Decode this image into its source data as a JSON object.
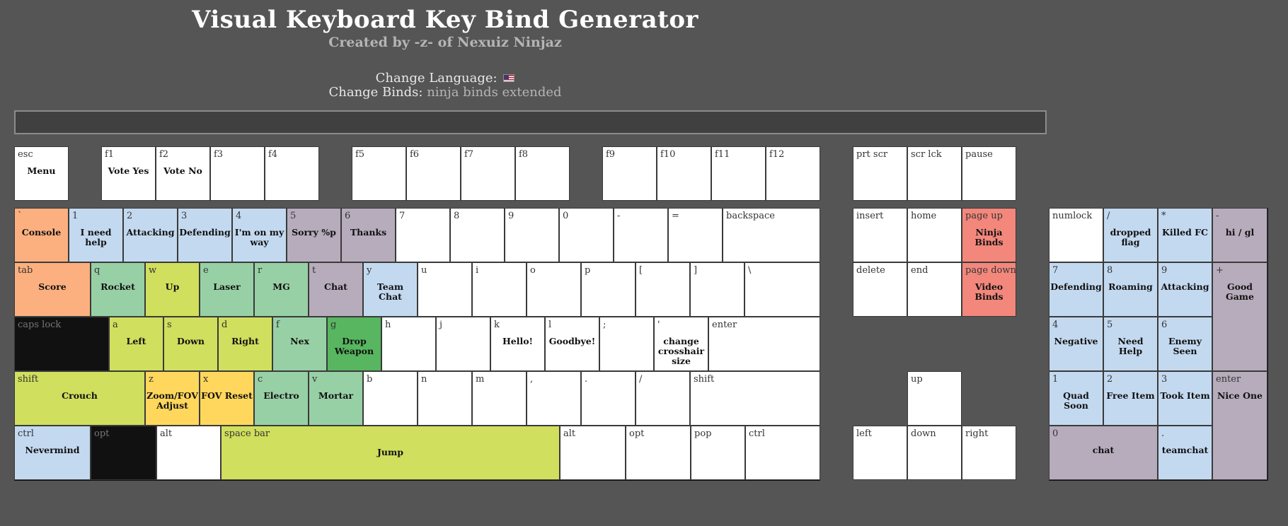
{
  "header": {
    "title": "Visual Keyboard Key Bind Generator",
    "subtitle": "Created by -z- of Nexuiz Ninjaz",
    "language_label": "Change Language:",
    "binds_label": "Change Binds:",
    "binds_value": "ninja binds extended"
  },
  "colors": {
    "background": "#555555",
    "orange": "#fcb07f",
    "blue": "#c3d9f0",
    "mauve": "#b6acbb",
    "green": "#98d0a6",
    "lime": "#d0df5d",
    "dark_green": "#57b65f",
    "yellow": "#ffd75c",
    "red": "#f3877c",
    "black": "#111111",
    "white": "#ffffff"
  },
  "keys": [
    {
      "id": "esc",
      "label": "esc",
      "bind": "Menu",
      "color": "white"
    },
    {
      "id": "f1",
      "label": "f1",
      "bind": "Vote Yes",
      "color": "white"
    },
    {
      "id": "f2",
      "label": "f2",
      "bind": "Vote No",
      "color": "white"
    },
    {
      "id": "f3",
      "label": "f3",
      "bind": "",
      "color": "white"
    },
    {
      "id": "f4",
      "label": "f4",
      "bind": "",
      "color": "white"
    },
    {
      "id": "f5",
      "label": "f5",
      "bind": "",
      "color": "white"
    },
    {
      "id": "f6",
      "label": "f6",
      "bind": "",
      "color": "white"
    },
    {
      "id": "f7",
      "label": "f7",
      "bind": "",
      "color": "white"
    },
    {
      "id": "f8",
      "label": "f8",
      "bind": "",
      "color": "white"
    },
    {
      "id": "f9",
      "label": "f9",
      "bind": "",
      "color": "white"
    },
    {
      "id": "f10",
      "label": "f10",
      "bind": "",
      "color": "white"
    },
    {
      "id": "f11",
      "label": "f11",
      "bind": "",
      "color": "white"
    },
    {
      "id": "f12",
      "label": "f12",
      "bind": "",
      "color": "white"
    },
    {
      "id": "prtscr",
      "label": "prt scr",
      "bind": "",
      "color": "white"
    },
    {
      "id": "scrlck",
      "label": "scr lck",
      "bind": "",
      "color": "white"
    },
    {
      "id": "pause",
      "label": "pause",
      "bind": "",
      "color": "white"
    },
    {
      "id": "backtick",
      "label": "`",
      "bind": "Console",
      "color": "orange"
    },
    {
      "id": "1",
      "label": "1",
      "bind": "I need help",
      "color": "blue"
    },
    {
      "id": "2",
      "label": "2",
      "bind": "Attacking",
      "color": "blue"
    },
    {
      "id": "3",
      "label": "3",
      "bind": "Defending",
      "color": "blue"
    },
    {
      "id": "4",
      "label": "4",
      "bind": "I'm on my way",
      "color": "blue"
    },
    {
      "id": "5",
      "label": "5",
      "bind": "Sorry %p",
      "color": "mauve"
    },
    {
      "id": "6",
      "label": "6",
      "bind": "Thanks",
      "color": "mauve"
    },
    {
      "id": "7",
      "label": "7",
      "bind": "",
      "color": "white"
    },
    {
      "id": "8",
      "label": "8",
      "bind": "",
      "color": "white"
    },
    {
      "id": "9",
      "label": "9",
      "bind": "",
      "color": "white"
    },
    {
      "id": "0",
      "label": "0",
      "bind": "",
      "color": "white"
    },
    {
      "id": "minus",
      "label": "-",
      "bind": "",
      "color": "white"
    },
    {
      "id": "equals",
      "label": "=",
      "bind": "",
      "color": "white"
    },
    {
      "id": "backspace",
      "label": "backspace",
      "bind": "",
      "color": "white"
    },
    {
      "id": "tab",
      "label": "tab",
      "bind": "Score",
      "color": "orange"
    },
    {
      "id": "q",
      "label": "q",
      "bind": "Rocket",
      "color": "green"
    },
    {
      "id": "w",
      "label": "w",
      "bind": "Up",
      "color": "lime"
    },
    {
      "id": "e",
      "label": "e",
      "bind": "Laser",
      "color": "green"
    },
    {
      "id": "r",
      "label": "r",
      "bind": "MG",
      "color": "green"
    },
    {
      "id": "t",
      "label": "t",
      "bind": "Chat",
      "color": "mauve"
    },
    {
      "id": "y",
      "label": "y",
      "bind": "Team Chat",
      "color": "blue"
    },
    {
      "id": "u",
      "label": "u",
      "bind": "",
      "color": "white"
    },
    {
      "id": "i",
      "label": "i",
      "bind": "",
      "color": "white"
    },
    {
      "id": "o",
      "label": "o",
      "bind": "",
      "color": "white"
    },
    {
      "id": "p",
      "label": "p",
      "bind": "",
      "color": "white"
    },
    {
      "id": "lbracket",
      "label": "[",
      "bind": "",
      "color": "white"
    },
    {
      "id": "rbracket",
      "label": "]",
      "bind": "",
      "color": "white"
    },
    {
      "id": "backslash",
      "label": "\\",
      "bind": "",
      "color": "white"
    },
    {
      "id": "capslock",
      "label": "caps lock",
      "bind": "",
      "color": "black"
    },
    {
      "id": "a",
      "label": "a",
      "bind": "Left",
      "color": "lime"
    },
    {
      "id": "s",
      "label": "s",
      "bind": "Down",
      "color": "lime"
    },
    {
      "id": "d",
      "label": "d",
      "bind": "Right",
      "color": "lime"
    },
    {
      "id": "f",
      "label": "f",
      "bind": "Nex",
      "color": "green"
    },
    {
      "id": "g",
      "label": "g",
      "bind": "Drop Weapon",
      "color": "dgreen"
    },
    {
      "id": "h",
      "label": "h",
      "bind": "",
      "color": "white"
    },
    {
      "id": "j",
      "label": "j",
      "bind": "",
      "color": "white"
    },
    {
      "id": "k",
      "label": "k",
      "bind": "Hello!",
      "color": "white"
    },
    {
      "id": "l",
      "label": "l",
      "bind": "Goodbye!",
      "color": "white"
    },
    {
      "id": "semicolon",
      "label": ";",
      "bind": "",
      "color": "white"
    },
    {
      "id": "quote",
      "label": "'",
      "bind": "change crosshair size",
      "color": "white"
    },
    {
      "id": "enter",
      "label": "enter",
      "bind": "",
      "color": "white"
    },
    {
      "id": "lshift",
      "label": "shift",
      "bind": "Crouch",
      "color": "lime"
    },
    {
      "id": "z",
      "label": "z",
      "bind": "Zoom/FOV Adjust",
      "color": "yellow"
    },
    {
      "id": "x",
      "label": "x",
      "bind": "FOV Reset",
      "color": "yellow"
    },
    {
      "id": "c",
      "label": "c",
      "bind": "Electro",
      "color": "green"
    },
    {
      "id": "v",
      "label": "v",
      "bind": "Mortar",
      "color": "green"
    },
    {
      "id": "b",
      "label": "b",
      "bind": "",
      "color": "white"
    },
    {
      "id": "n",
      "label": "n",
      "bind": "",
      "color": "white"
    },
    {
      "id": "m",
      "label": "m",
      "bind": "",
      "color": "white"
    },
    {
      "id": "comma",
      "label": ",",
      "bind": "",
      "color": "white"
    },
    {
      "id": "period",
      "label": ".",
      "bind": "",
      "color": "white"
    },
    {
      "id": "slash",
      "label": "/",
      "bind": "",
      "color": "white"
    },
    {
      "id": "rshift",
      "label": "shift",
      "bind": "",
      "color": "white"
    },
    {
      "id": "lctrl",
      "label": "ctrl",
      "bind": "Nevermind",
      "color": "blue"
    },
    {
      "id": "lopt",
      "label": "opt",
      "bind": "",
      "color": "black"
    },
    {
      "id": "lalt",
      "label": "alt",
      "bind": "",
      "color": "white"
    },
    {
      "id": "space",
      "label": "space bar",
      "bind": "Jump",
      "color": "lime"
    },
    {
      "id": "ralt",
      "label": "alt",
      "bind": "",
      "color": "white"
    },
    {
      "id": "ropt",
      "label": "opt",
      "bind": "",
      "color": "white"
    },
    {
      "id": "pop",
      "label": "pop",
      "bind": "",
      "color": "white"
    },
    {
      "id": "rctrl",
      "label": "ctrl",
      "bind": "",
      "color": "white"
    },
    {
      "id": "insert",
      "label": "insert",
      "bind": "",
      "color": "white"
    },
    {
      "id": "home",
      "label": "home",
      "bind": "",
      "color": "white"
    },
    {
      "id": "pageup",
      "label": "page up",
      "bind": "Ninja Binds",
      "color": "red"
    },
    {
      "id": "delete",
      "label": "delete",
      "bind": "",
      "color": "white"
    },
    {
      "id": "end",
      "label": "end",
      "bind": "",
      "color": "white"
    },
    {
      "id": "pagedown",
      "label": "page down",
      "bind": "Video Binds",
      "color": "red"
    },
    {
      "id": "up",
      "label": "up",
      "bind": "",
      "color": "white"
    },
    {
      "id": "left",
      "label": "left",
      "bind": "",
      "color": "white"
    },
    {
      "id": "down",
      "label": "down",
      "bind": "",
      "color": "white"
    },
    {
      "id": "right",
      "label": "right",
      "bind": "",
      "color": "white"
    },
    {
      "id": "numlock",
      "label": "numlock",
      "bind": "",
      "color": "white"
    },
    {
      "id": "kp_slash",
      "label": "/",
      "bind": "dropped flag",
      "color": "blue"
    },
    {
      "id": "kp_star",
      "label": "*",
      "bind": "Killed FC",
      "color": "blue"
    },
    {
      "id": "kp_minus",
      "label": "-",
      "bind": "hi / gl",
      "color": "mauve"
    },
    {
      "id": "kp7",
      "label": "7",
      "bind": "Defending",
      "color": "blue"
    },
    {
      "id": "kp8",
      "label": "8",
      "bind": "Roaming",
      "color": "blue"
    },
    {
      "id": "kp9",
      "label": "9",
      "bind": "Attacking",
      "color": "blue"
    },
    {
      "id": "kp_plus",
      "label": "+",
      "bind": "Good Game",
      "color": "mauve"
    },
    {
      "id": "kp4",
      "label": "4",
      "bind": "Negative",
      "color": "blue"
    },
    {
      "id": "kp5",
      "label": "5",
      "bind": "Need Help",
      "color": "blue"
    },
    {
      "id": "kp6",
      "label": "6",
      "bind": "Enemy Seen",
      "color": "blue"
    },
    {
      "id": "kp1",
      "label": "1",
      "bind": "Quad Soon",
      "color": "blue"
    },
    {
      "id": "kp2",
      "label": "2",
      "bind": "Free Item",
      "color": "blue"
    },
    {
      "id": "kp3",
      "label": "3",
      "bind": "Took Item",
      "color": "blue"
    },
    {
      "id": "kp_enter",
      "label": "enter",
      "bind": "Nice One",
      "color": "mauve"
    },
    {
      "id": "kp0",
      "label": "0",
      "bind": "chat",
      "color": "mauve"
    },
    {
      "id": "kp_dot",
      "label": ".",
      "bind": "teamchat",
      "color": "blue"
    }
  ]
}
